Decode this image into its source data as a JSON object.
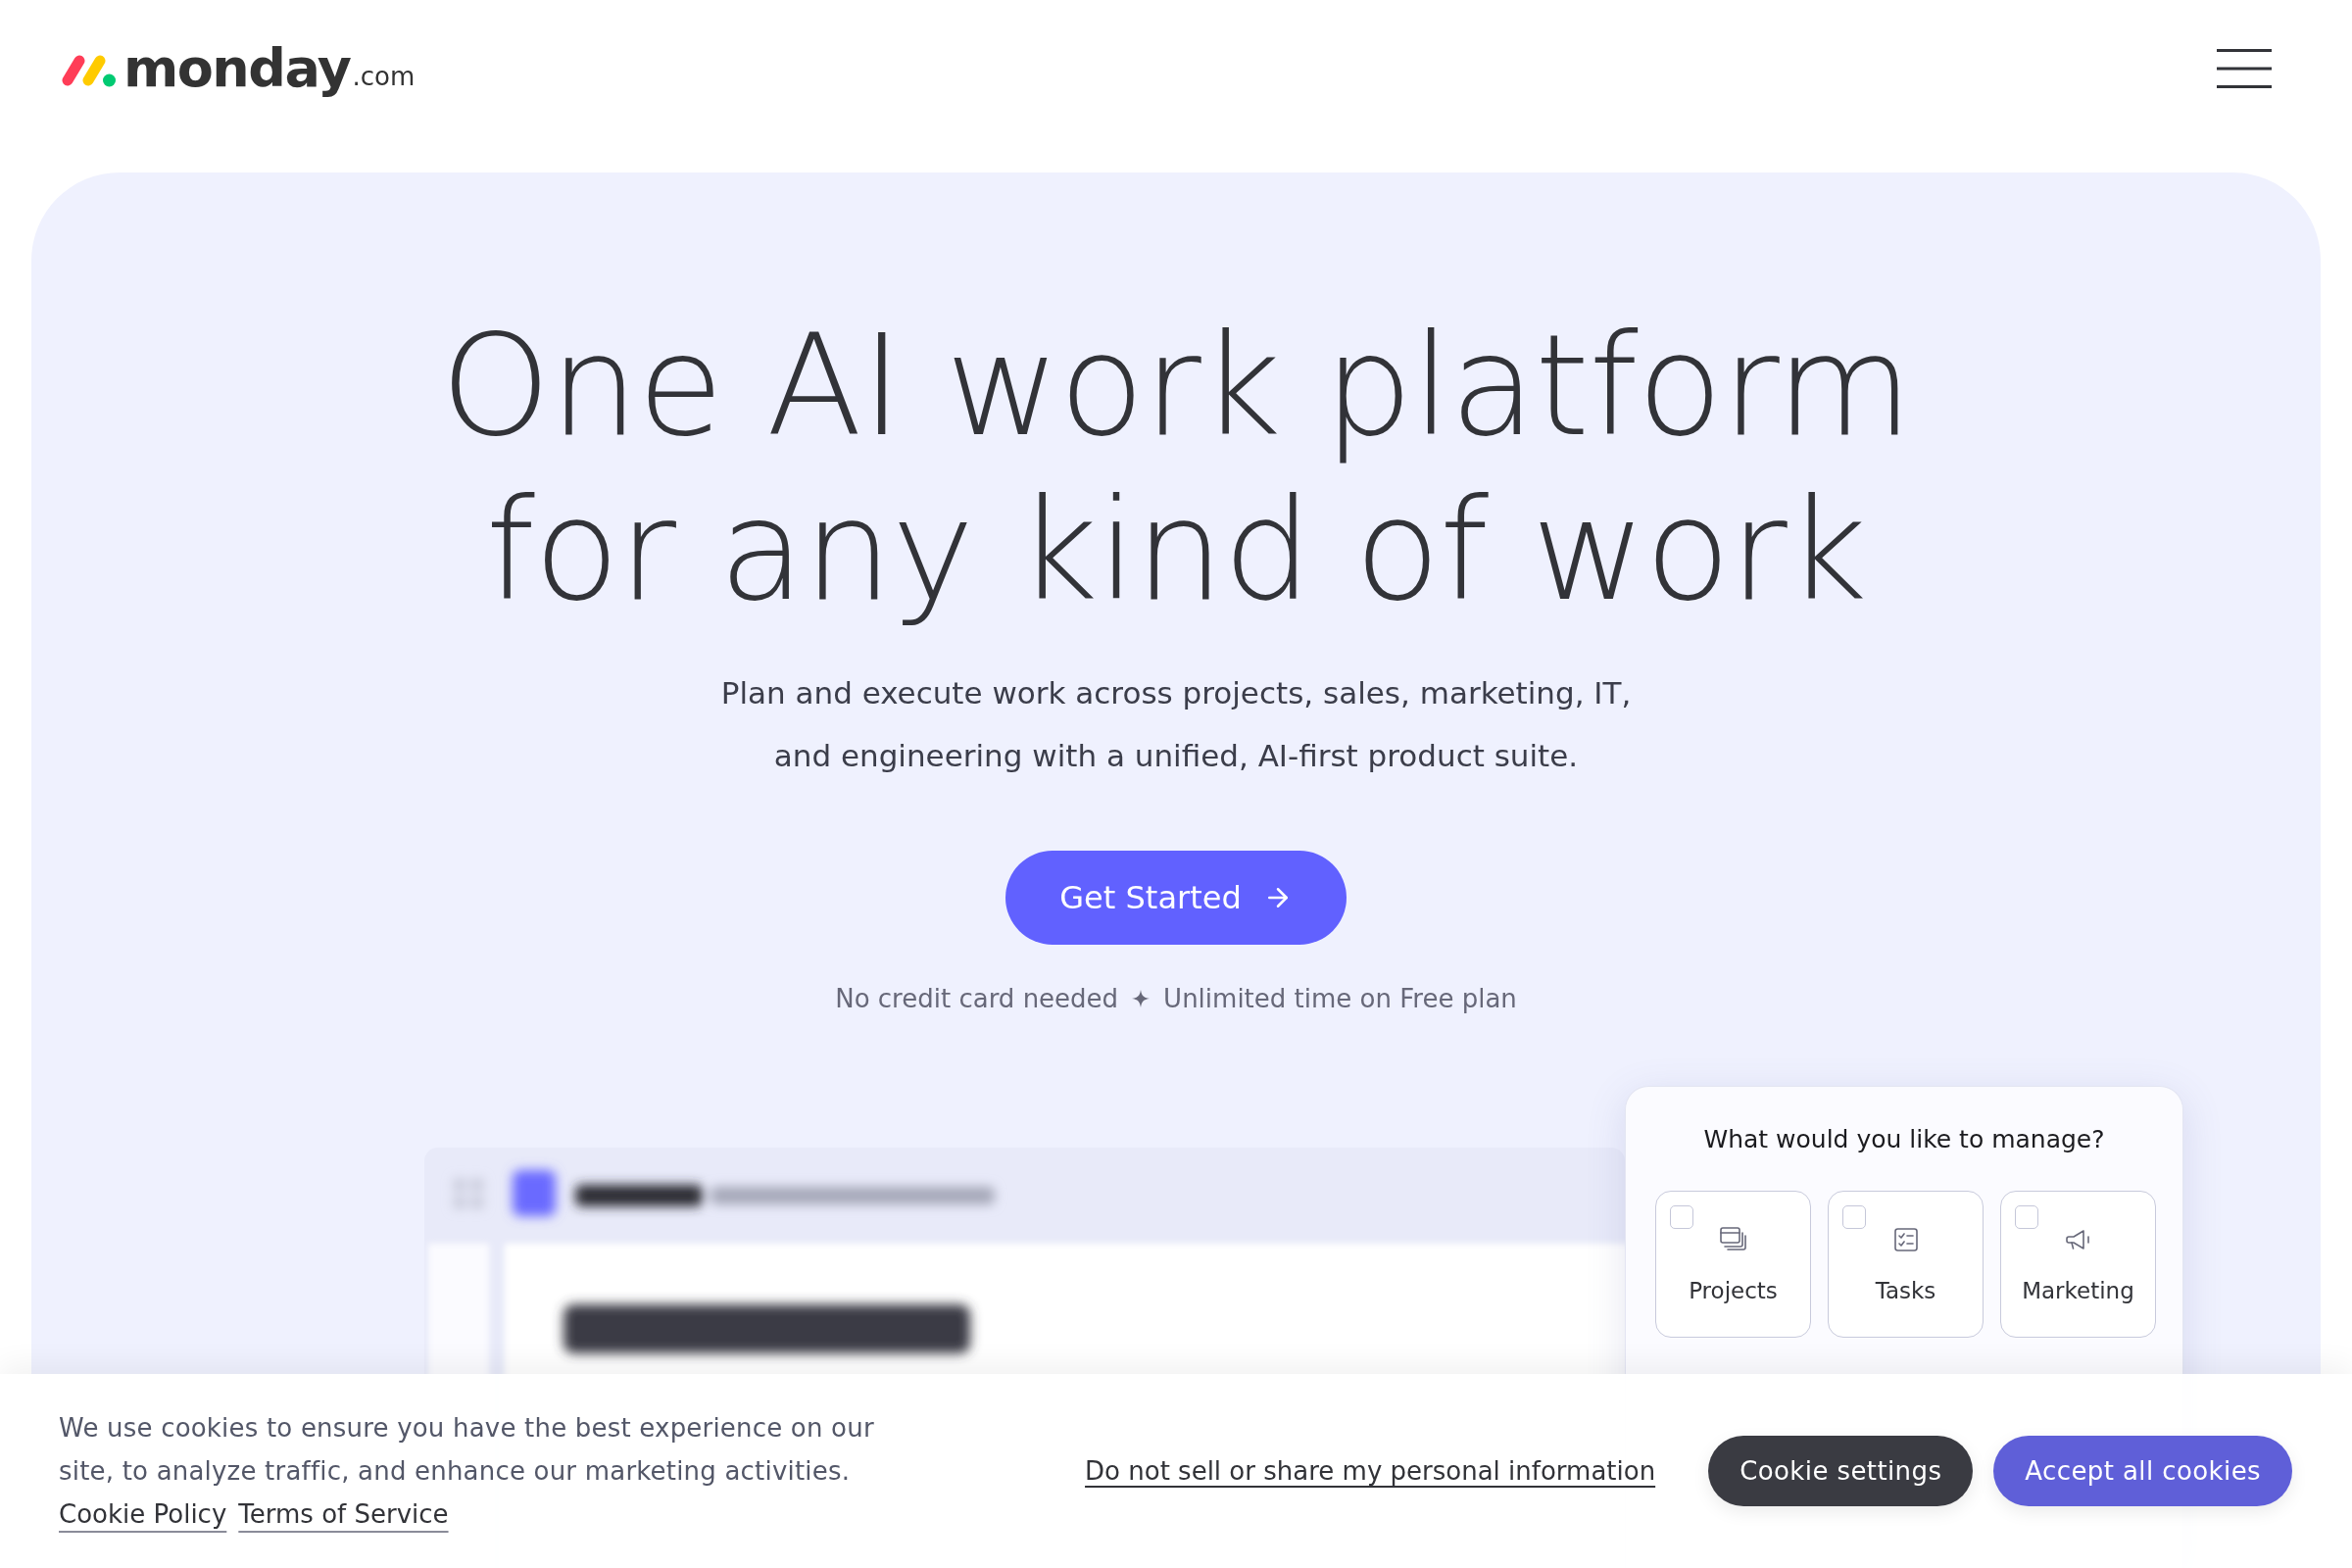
{
  "header": {
    "logo": {
      "wordmark": "monday",
      "suffix": ".com"
    }
  },
  "hero": {
    "headline_lines": [
      "One AI work platform",
      "for any kind of work"
    ],
    "subtitle_lines": [
      "Plan and execute work across projects, sales, marketing, IT,",
      "and engineering with a unified, AI-first product suite."
    ],
    "cta": {
      "label": "Get Started"
    },
    "perks": [
      "No credit card needed",
      "Unlimited time on Free plan"
    ]
  },
  "manage_card": {
    "title": "What would you like to manage?",
    "options": [
      {
        "label": "Projects",
        "checked": false
      },
      {
        "label": "Tasks",
        "checked": false
      },
      {
        "label": "Marketing",
        "checked": false
      }
    ]
  },
  "cookie_banner": {
    "message_lines": [
      "We use cookies to ensure you have the best experience on our",
      "site, to analyze traffic, and enhance our marketing activities."
    ],
    "links": [
      "Cookie Policy",
      "Terms of Service"
    ],
    "privacy_link": "Do not sell or share my personal information",
    "buttons": [
      {
        "label": "Cookie settings",
        "kind": "secondary"
      },
      {
        "label": "Accept all cookies",
        "kind": "primary"
      }
    ]
  }
}
